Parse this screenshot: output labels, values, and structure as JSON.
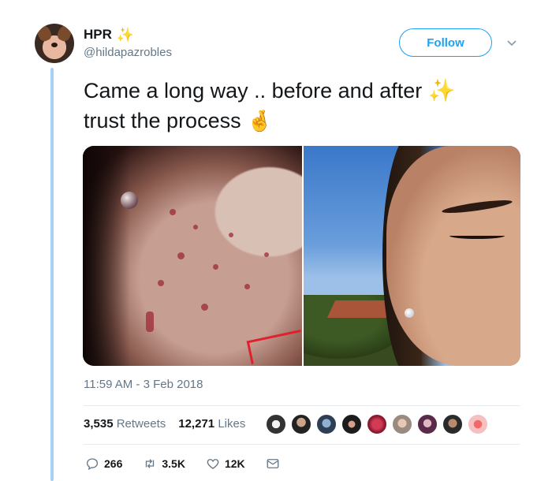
{
  "tweet": {
    "display_name": "HPR",
    "handle": "@hildapazrobles",
    "follow_label": "Follow",
    "text_line1": "Came a long way .. before and after",
    "text_line2": "trust the process",
    "timestamp": "11:59 AM - 3 Feb 2018",
    "retweets_count": "3,535",
    "retweets_label": "Retweets",
    "likes_count": "12,271",
    "likes_label": "Likes",
    "reply_count": "266",
    "retweet_action_count": "3.5K",
    "like_action_count": "12K"
  },
  "icons": {
    "name_emoji": "sparkles-icon",
    "text_emoji_1": "sparkles-icon",
    "text_emoji_2": "crossed-fingers-icon"
  },
  "colors": {
    "accent": "#1da1f2",
    "thread_line": "#a6d0f5",
    "muted_text": "#657786"
  }
}
